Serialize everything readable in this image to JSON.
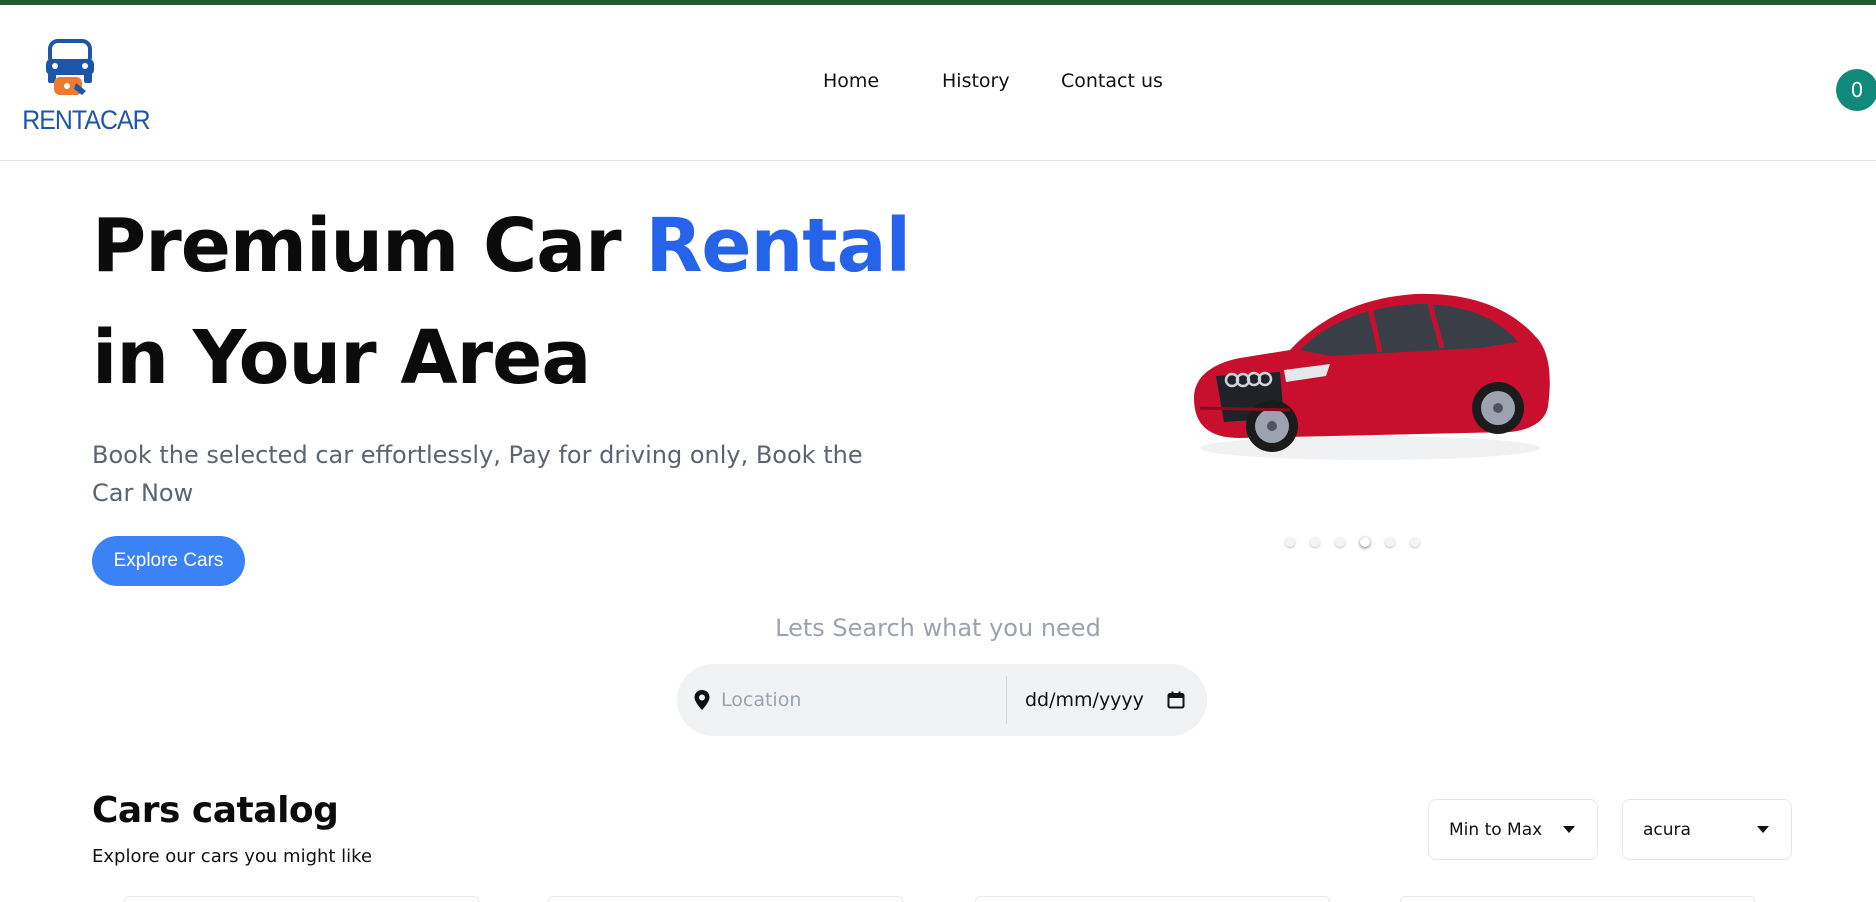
{
  "brand": {
    "logo_text": "RENTACAR",
    "accent_color": "#2563eb",
    "button_color": "#3b82f6",
    "top_strip_color": "#1f5c2e"
  },
  "nav": {
    "items": [
      {
        "label": "Home"
      },
      {
        "label": "History"
      },
      {
        "label": "Contact us"
      }
    ]
  },
  "cart": {
    "count": "0",
    "color": "#0f8a7a"
  },
  "hero": {
    "title_part1": "Premium Car ",
    "title_accent": "Rental",
    "title_part2": " in Your Area",
    "subtitle": "Book the selected car effortlessly, Pay for driving only, Book the Car Now",
    "cta_label": "Explore Cars",
    "carousel": {
      "slide_count": 6,
      "active_index": 3,
      "image": "red-sedan-car"
    }
  },
  "search": {
    "heading": "Lets Search what you need",
    "location_placeholder": "Location",
    "location_icon": "map-pin-icon",
    "date_value": "dd/mm/yyyy",
    "date_icon": "calendar-icon"
  },
  "catalog": {
    "title": "Cars catalog",
    "subtitle": "Explore our cars you might like",
    "sort_value": "Min to Max",
    "brand_value": "acura"
  }
}
